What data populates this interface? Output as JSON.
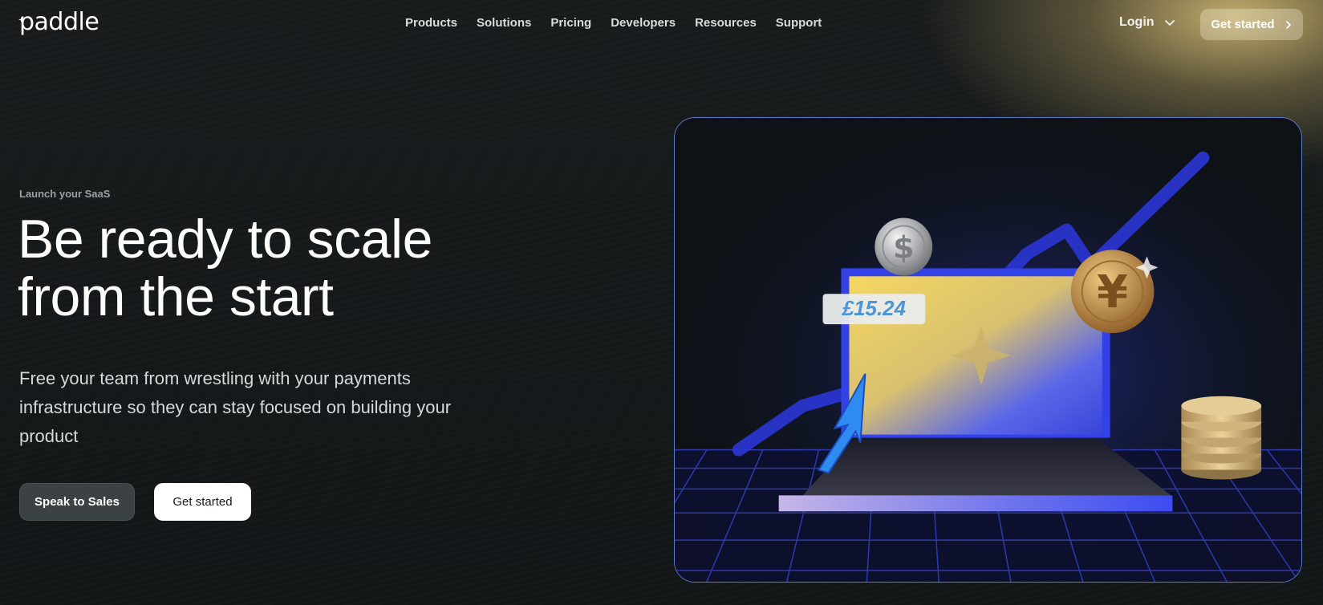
{
  "nav": {
    "logo_text": "paddle",
    "links": [
      "Products",
      "Solutions",
      "Pricing",
      "Developers",
      "Resources",
      "Support"
    ],
    "login_label": "Login",
    "cta_label": "Get started"
  },
  "hero": {
    "eyebrow": "Launch your SaaS",
    "headline_line1": "Be ready to scale",
    "headline_line2": "from the start",
    "subhead": "Free your team from wrestling with your payments infrastructure so they can stay focused on building your product",
    "primary_button": "Speak to Sales",
    "secondary_button": "Get started"
  },
  "illustration": {
    "price_tag": "£15.24",
    "coin_dollar_symbol": "$",
    "coin_yen_symbol": "¥"
  },
  "colors": {
    "background": "#141819",
    "accent_gold": "#d9c27a",
    "illustration_blue": "#3a49e8",
    "illustration_yellow": "#f2d25a"
  }
}
